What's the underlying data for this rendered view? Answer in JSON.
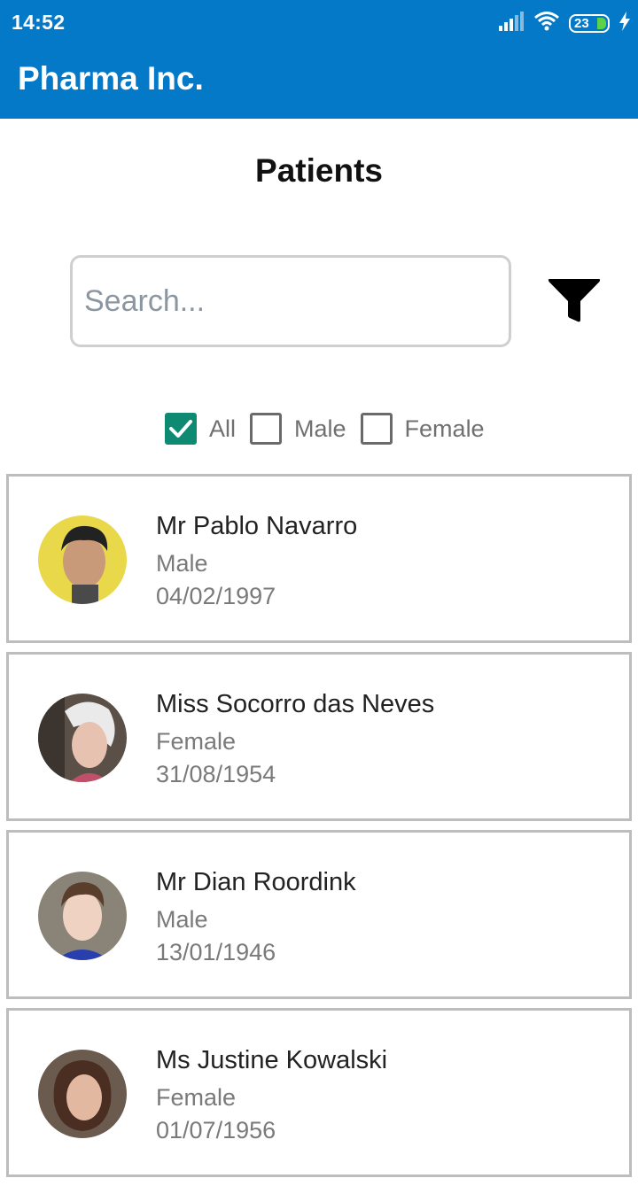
{
  "status_bar": {
    "time": "14:52",
    "battery": "23",
    "icons": [
      "signal-icon",
      "wifi-icon",
      "battery-icon",
      "charging-icon"
    ]
  },
  "app_bar": {
    "title": "Pharma Inc."
  },
  "page": {
    "title": "Patients"
  },
  "search": {
    "placeholder": "Search...",
    "value": ""
  },
  "filter": {
    "icon": "filter-icon"
  },
  "gender_filter": [
    {
      "label": "All",
      "checked": true
    },
    {
      "label": "Male",
      "checked": false
    },
    {
      "label": "Female",
      "checked": false
    }
  ],
  "patients": [
    {
      "name": "Mr Pablo Navarro",
      "gender": "Male",
      "dob": "04/02/1997"
    },
    {
      "name": "Miss Socorro das Neves",
      "gender": "Female",
      "dob": "31/08/1954"
    },
    {
      "name": "Mr Dian Roordink",
      "gender": "Male",
      "dob": "13/01/1946"
    },
    {
      "name": "Ms Justine Kowalski",
      "gender": "Female",
      "dob": "01/07/1956"
    }
  ],
  "colors": {
    "primary": "#0479c8",
    "checkbox_checked": "#0e8a73",
    "card_border": "#bdbdbd",
    "battery_fill": "#5bd24a"
  }
}
